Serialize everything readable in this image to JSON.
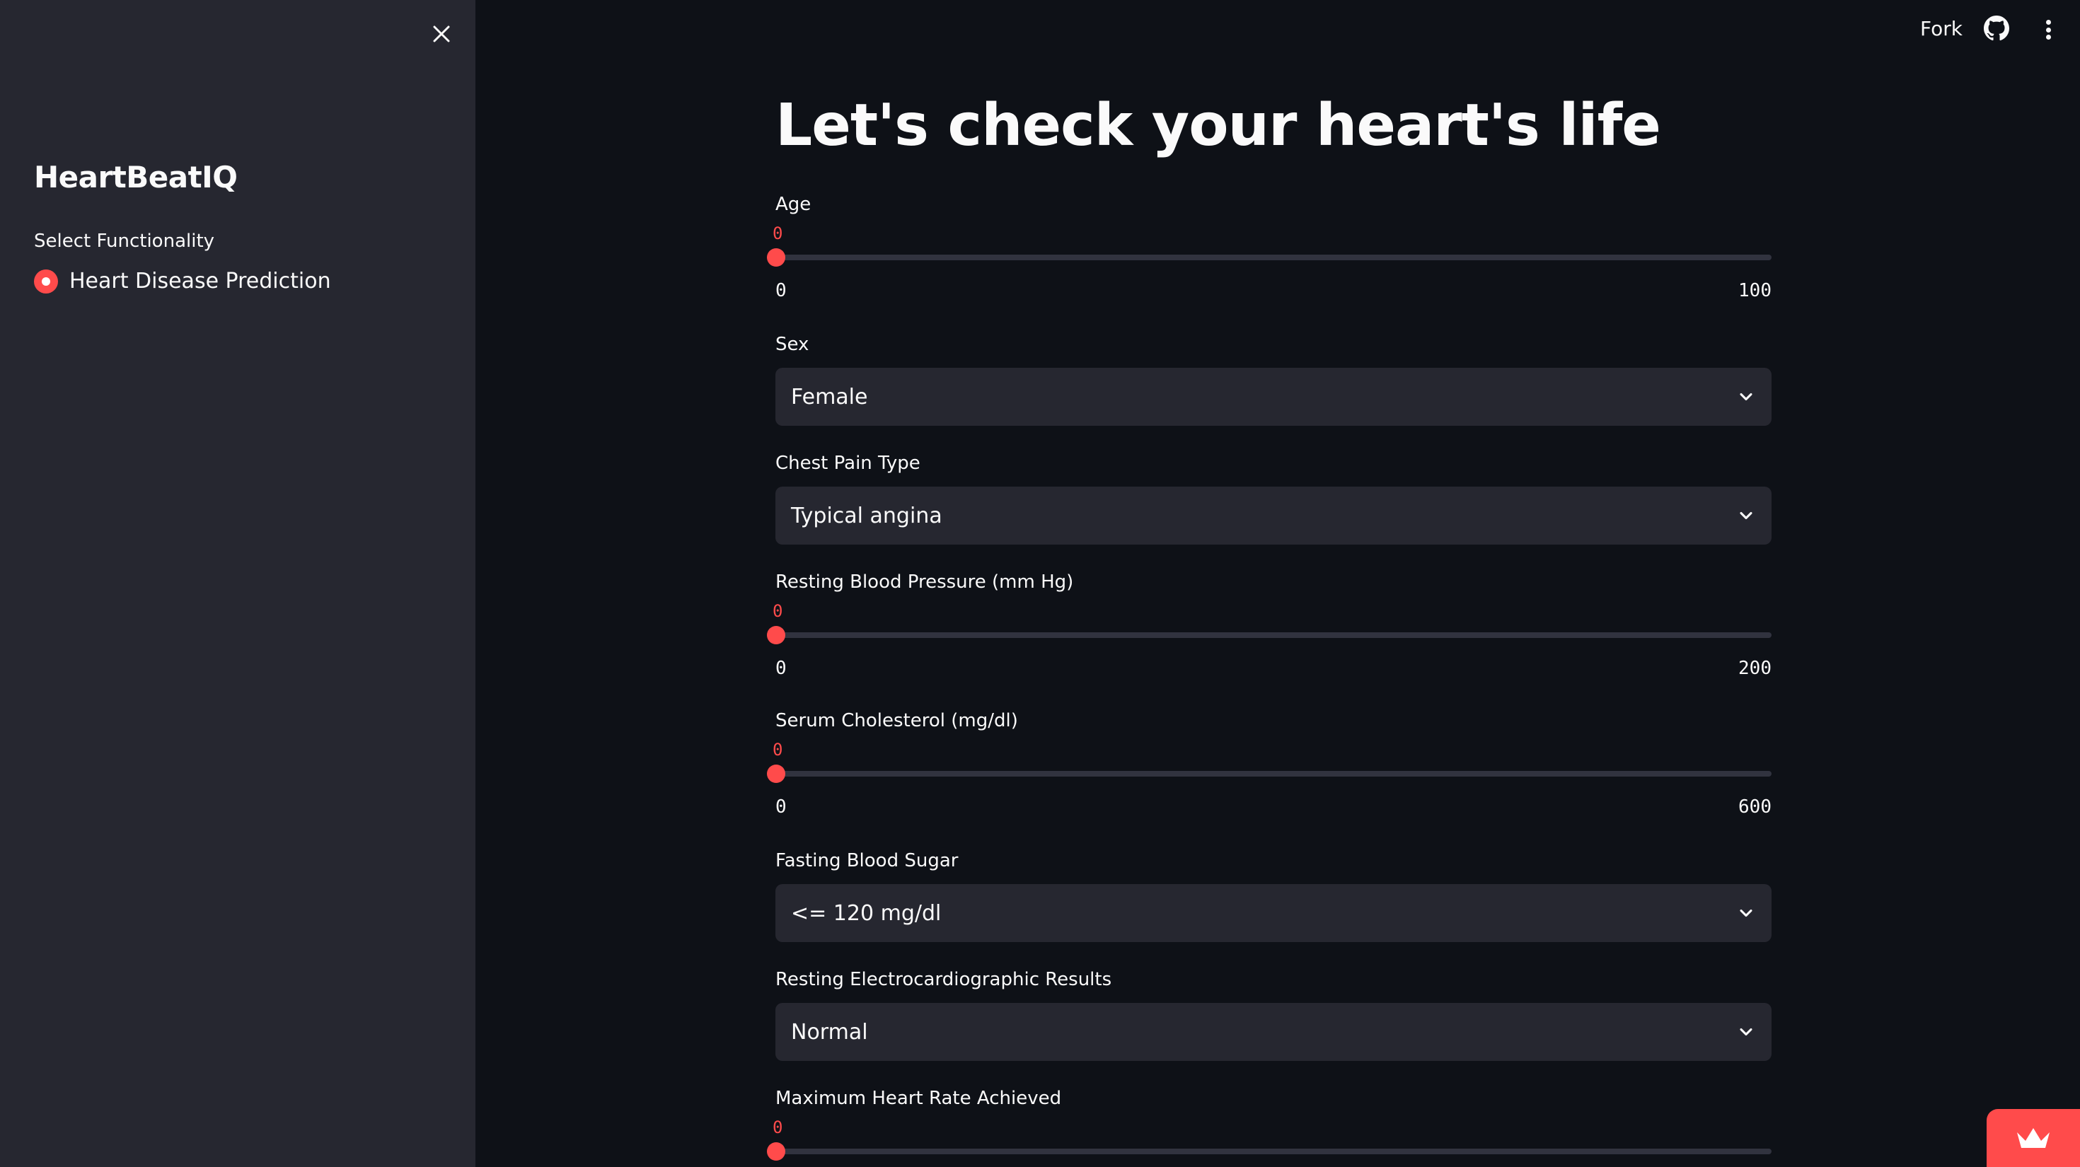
{
  "sidebar": {
    "title": "HeartBeatIQ",
    "select_label": "Select Functionality",
    "options": [
      {
        "label": "Heart Disease Prediction",
        "selected": true
      }
    ]
  },
  "header": {
    "fork_label": "Fork"
  },
  "main": {
    "title": "Let's check your heart's life",
    "age": {
      "label": "Age",
      "value": "0",
      "min": "0",
      "max": "100"
    },
    "sex": {
      "label": "Sex",
      "value": "Female"
    },
    "chest_pain": {
      "label": "Chest Pain Type",
      "value": "Typical angina"
    },
    "resting_bp": {
      "label": "Resting Blood Pressure (mm Hg)",
      "value": "0",
      "min": "0",
      "max": "200"
    },
    "cholesterol": {
      "label": "Serum Cholesterol (mg/dl)",
      "value": "0",
      "min": "0",
      "max": "600"
    },
    "fasting_sugar": {
      "label": "Fasting Blood Sugar",
      "value": "<= 120 mg/dl"
    },
    "ecg": {
      "label": "Resting Electrocardiographic Results",
      "value": "Normal"
    },
    "max_hr": {
      "label": "Maximum Heart Rate Achieved",
      "value": "0"
    }
  },
  "colors": {
    "accent": "#ff4b4b",
    "background": "#0e1117",
    "sidebar": "#262730",
    "input": "#262730"
  },
  "icons": {
    "close": "close-icon",
    "github": "github-icon",
    "menu": "more-vertical-icon",
    "chevron": "chevron-down-icon",
    "badge": "crown-icon"
  }
}
